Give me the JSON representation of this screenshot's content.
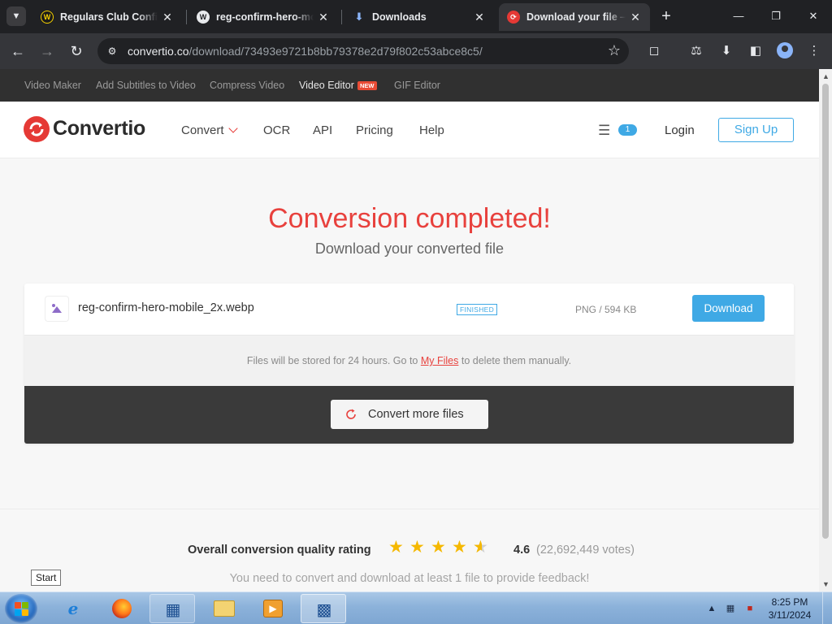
{
  "browser": {
    "tabs": [
      {
        "title": "Regulars Club Confirm",
        "active": false
      },
      {
        "title": "reg-confirm-hero-mobile",
        "active": false
      },
      {
        "title": "Downloads",
        "active": false
      },
      {
        "title": "Download your file — Convertio",
        "active": true
      }
    ],
    "url_host": "convertio.co",
    "url_path": "/download/73493e9721b8bb79378e2d79f802c53abce8c5/"
  },
  "topstrip": {
    "links": [
      "Video Maker",
      "Add Subtitles to Video",
      "Compress Video",
      "Video Editor",
      "GIF Editor"
    ],
    "new_badge": "NEW"
  },
  "header": {
    "logo": "Convertio",
    "nav": [
      "Convert",
      "OCR",
      "API",
      "Pricing",
      "Help"
    ],
    "file_count": "1",
    "login": "Login",
    "signup": "Sign Up"
  },
  "hero": {
    "title": "Conversion completed!",
    "subtitle": "Download your converted file"
  },
  "file": {
    "name": "reg-confirm-hero-mobile_2x.webp",
    "status": "FINISHED",
    "meta": "PNG / 594 KB",
    "download": "Download"
  },
  "storage_note": {
    "before": "Files will be stored for 24 hours. Go to",
    "link": "My Files",
    "after": "to delete them manually."
  },
  "convert_more": "Convert more files",
  "rating": {
    "label": "Overall conversion quality rating",
    "value": "4.6",
    "stars_filled": 4.5,
    "votes": "(22,692,449 votes)",
    "feedback": "You need to convert and download at least 1 file to provide feedback!"
  },
  "tooltip": "Start",
  "taskbar": {
    "time": "8:25 PM",
    "date": "3/11/2024"
  },
  "colors": {
    "brand_red": "#e8413d",
    "accent_blue": "#3fa9e5",
    "star": "#f5b800"
  }
}
